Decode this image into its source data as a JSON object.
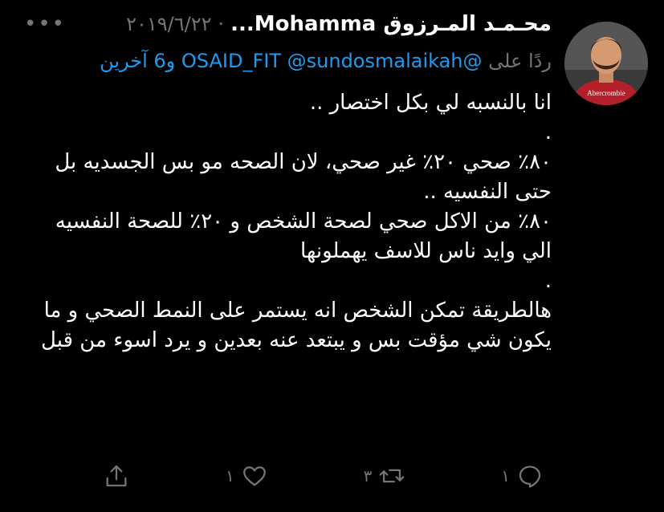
{
  "tweet": {
    "display_name": "محـمـد المـرزوق Mohamma...",
    "dot": "·",
    "date": "٢٠١٩/٦/٢٢",
    "more": "•••",
    "replying_prefix": "ردًا على",
    "mention_1": "@OSAID_FIT",
    "mention_2": "@sundosmalaikah",
    "others": "و6 آخرين",
    "body": "انا بالنسبه لي بكل اختصار ..\n.\n٨٠٪ صحي ٢٠٪ غير صحي، لان الصحه مو بس الجسديه بل حتى النفسيه ..\n٨٠٪ من الاكل صحي لصحة الشخص و ٢٠٪ للصحة النفسيه الي وايد ناس للاسف يهملونها\n.\nهالطريقة تمكن الشخص انه يستمر على النمط الصحي و ما يكون شي مؤقت بس و يبتعد عنه بعدين و يرد اسوء من قبل"
  },
  "actions": {
    "reply_count": "١",
    "retweet_count": "٣",
    "like_count": "١",
    "share_count": ""
  },
  "icons": {
    "reply": "reply-icon",
    "retweet": "retweet-icon",
    "like": "heart-icon",
    "share": "share-icon",
    "avatar_shirt_text": "Abercrombie"
  },
  "colors": {
    "background": "#000000",
    "text": "#ffffff",
    "muted": "#71767b",
    "link": "#1d9bf0"
  }
}
